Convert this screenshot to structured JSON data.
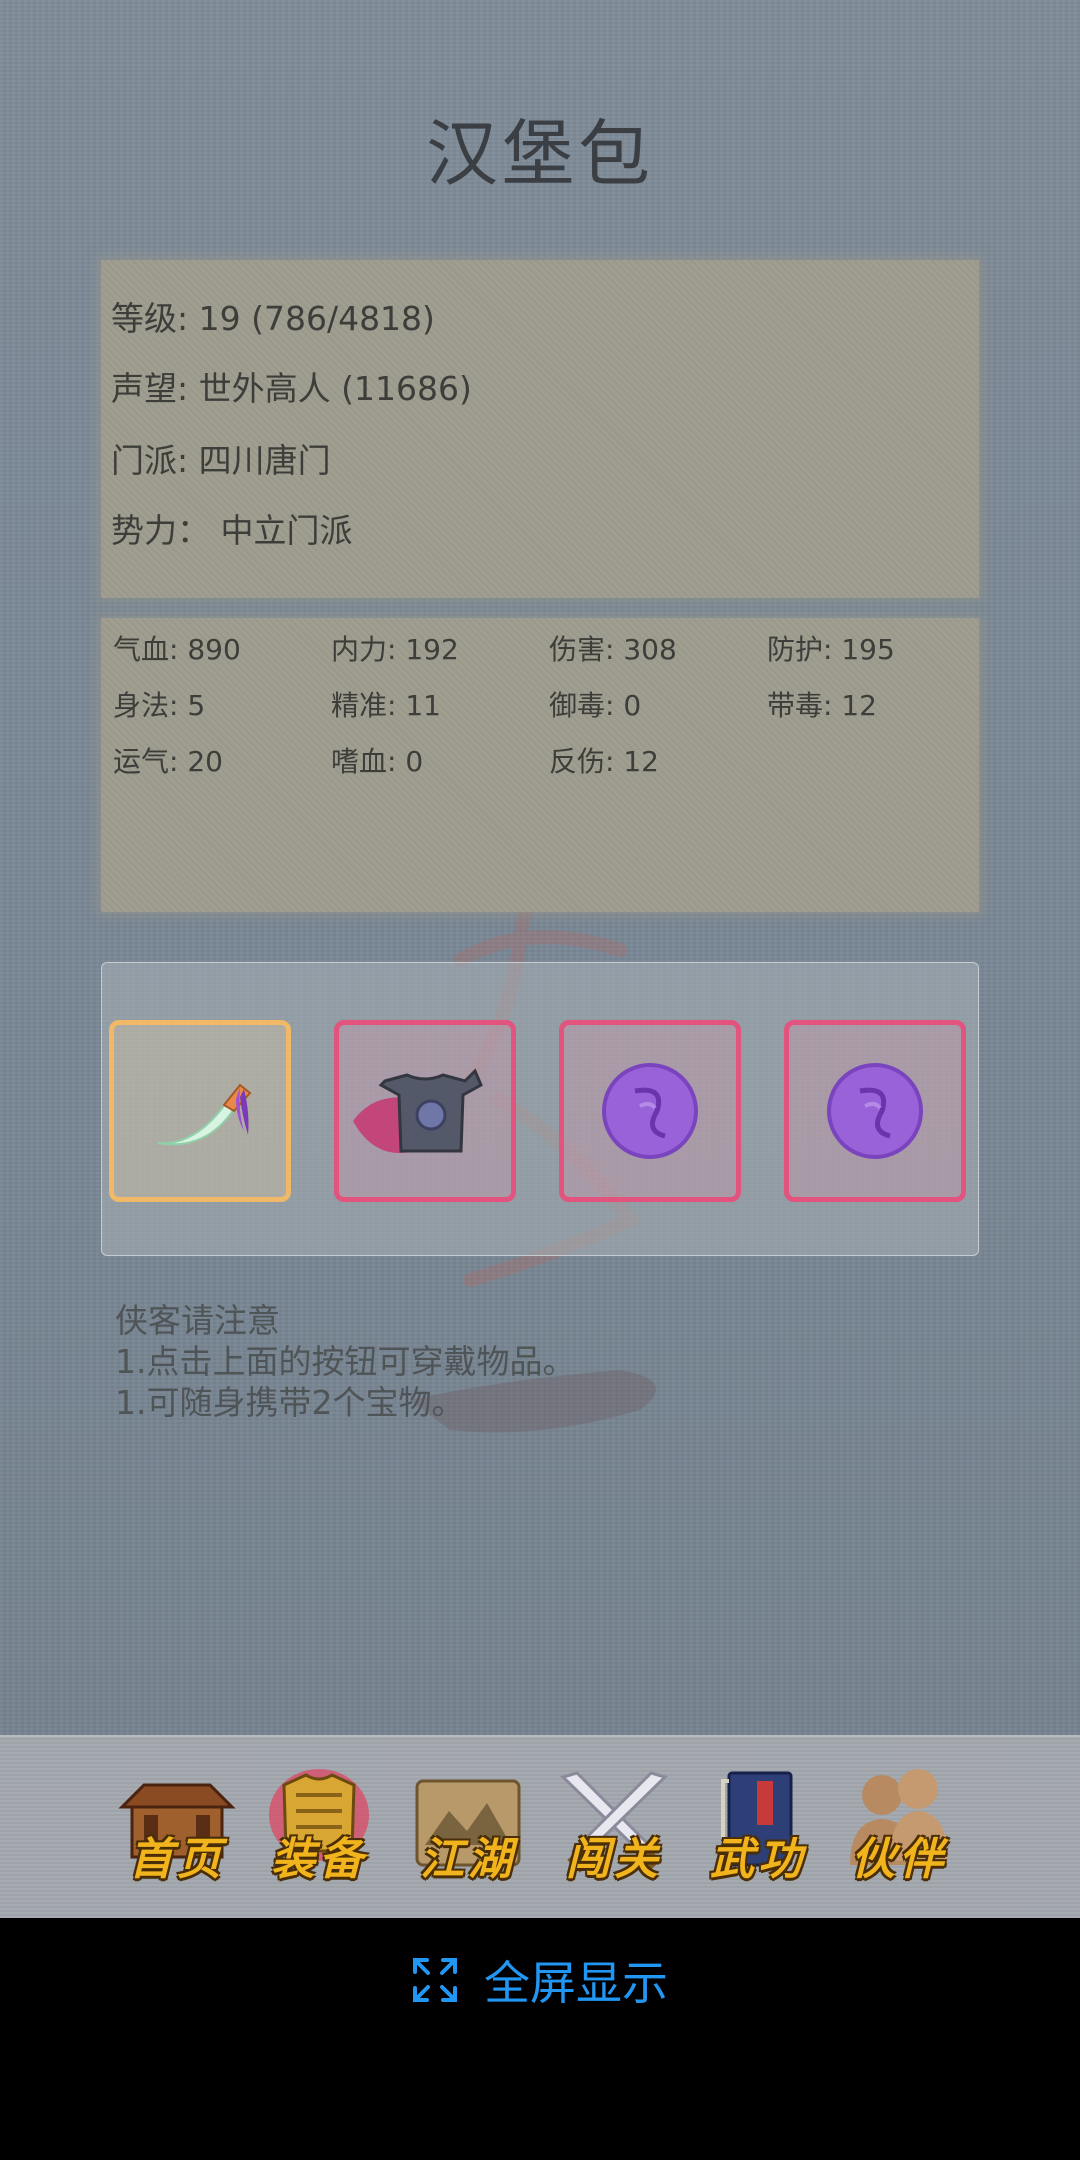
{
  "header": {
    "title": "汉堡包"
  },
  "profile": {
    "level": "等级: 19 (786/4818)",
    "reputation": "声望: 世外高人 (11686)",
    "sect": "门派: 四川唐门",
    "faction": "势力：  中立门派"
  },
  "stats": [
    {
      "label": "气血: 890"
    },
    {
      "label": "内力: 192"
    },
    {
      "label": "伤害: 308"
    },
    {
      "label": "防护: 195"
    },
    {
      "label": "身法: 5"
    },
    {
      "label": "精准: 11"
    },
    {
      "label": "御毒: 0"
    },
    {
      "label": "带毒: 12"
    },
    {
      "label": "运气: 20"
    },
    {
      "label": "嗜血: 0"
    },
    {
      "label": "反伤: 12"
    }
  ],
  "equipment": [
    {
      "icon": "saber-icon",
      "rarity": "gold"
    },
    {
      "icon": "armor-icon",
      "rarity": "pink"
    },
    {
      "icon": "treasure-orb-icon",
      "rarity": "pink"
    },
    {
      "icon": "treasure-orb-icon",
      "rarity": "pink"
    }
  ],
  "notes": {
    "title": "侠客请注意",
    "line1": "1.点击上面的按钮可穿戴物品。",
    "line2": "1.可随身携带2个宝物。"
  },
  "nav": [
    {
      "label": "首页",
      "icon": "house-icon"
    },
    {
      "label": "装备",
      "icon": "armor-icon"
    },
    {
      "label": "江湖",
      "icon": "map-scroll-icon"
    },
    {
      "label": "闯关",
      "icon": "crossed-swords-icon"
    },
    {
      "label": "武功",
      "icon": "book-icon"
    },
    {
      "label": "伙伴",
      "icon": "companions-icon"
    }
  ],
  "fullscreen": {
    "label": "全屏显示",
    "icon": "expand-icon"
  },
  "colors": {
    "background": "#7a8896",
    "panel": "#9e9c8e",
    "slot_gold": "#f0b867",
    "slot_pink": "#e2547e",
    "nav_label": "#f2b41d",
    "fullscreen": "#2196f3"
  }
}
